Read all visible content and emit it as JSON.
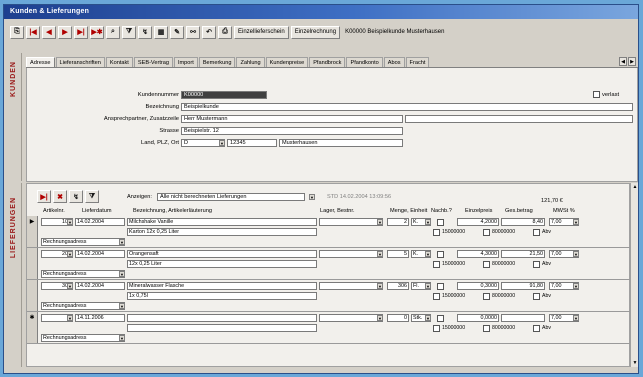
{
  "window": {
    "title": "Kunden & Lieferungen"
  },
  "toolbar": {
    "buttons": [
      "first",
      "prev",
      "next",
      "last",
      "new",
      "search",
      "filter",
      "sort",
      "print",
      "copy",
      "find",
      "refresh",
      "delete"
    ],
    "btn1": "Einzellieferschein",
    "btn2": "Einzelrechnung",
    "info": "K00000 Beispielkunde Musterhausen"
  },
  "side": {
    "kunden": "KUNDEN",
    "lieferungen": "LIEFERUNGEN"
  },
  "tabs": [
    "Adresse",
    "Lieferanschriften",
    "Kontakt",
    "SEB-Vertrag",
    "Import",
    "Bemerkung",
    "Zahlung",
    "Kundenpreise",
    "Pfandbrock",
    "Pfandkonto",
    "Abos",
    "Fracht"
  ],
  "address": {
    "kundennummer_label": "Kundennummer",
    "kundennummer": "K00000",
    "verlast_label": "verlast",
    "bezeichnung_label": "Bezeichnung",
    "bezeichnung": "Beispielkunde",
    "ansprech_label": "Ansprechpartner, Zusatzzeile",
    "ansprech": "Herr Mustermann",
    "strasse_label": "Strasse",
    "strasse": "Beispielstr. 12",
    "ort_label": "Land, PLZ, Ort",
    "land": "D",
    "plz": "12345",
    "ort": "Musterhausen"
  },
  "deliveries": {
    "anzeigen_label": "Anzeigen:",
    "anzeigen_value": "Alle nicht berechneten Lieferungen",
    "stand": "STD 14.02.2004 13:09:56",
    "sum": "121,70 €",
    "headers": {
      "artikelnr": "Artikelnr.",
      "lieferdatum": "Lieferdatum",
      "bezeichnung": "Bezeichnung, Artikelerläuterung",
      "lager": "Lager, Bestnr.",
      "menge": "Menge, Einheit",
      "nachb": "Nachb.?",
      "einzelpreis": "Einzelpreis",
      "gesbetrag": "Ges.betrag",
      "mwst": "MWSt %"
    },
    "rows": [
      {
        "sel": "▶",
        "artnr": "101",
        "datum": "14.02.2004",
        "bez": "Milchshake Vanille",
        "bez2": "Karton 12x 0,25 Liter",
        "adr": "Rechnungsadress",
        "menge": "2",
        "einheit": "K.",
        "einzel": "4,2000",
        "ges": "8,40",
        "mwst": "7,00",
        "c1": "15000000",
        "c2": "80000000",
        "abv": "Abv"
      },
      {
        "sel": "",
        "artnr": "201",
        "datum": "14.02.2004",
        "bez": "Orangensaft",
        "bez2": "12x 0,25 Liter",
        "adr": "Rechnungsadress",
        "menge": "5",
        "einheit": "K.",
        "einzel": "4,3000",
        "ges": "21,50",
        "mwst": "7,00",
        "c1": "15000000",
        "c2": "80000000",
        "abv": "Abv"
      },
      {
        "sel": "",
        "artnr": "301",
        "datum": "14.02.2004",
        "bez": "Mineralwasser Flasche",
        "bez2": "1x 0,75l",
        "adr": "Rechnungsadress",
        "menge": "306",
        "einheit": "Fl.",
        "einzel": "0,3000",
        "ges": "91,80",
        "mwst": "7,00",
        "c1": "15000000",
        "c2": "80000000",
        "abv": "Abv"
      },
      {
        "sel": "✱",
        "artnr": "0",
        "datum": "14.11.2006",
        "bez": "",
        "bez2": "",
        "adr": "Rechnungsadress",
        "menge": "0",
        "einheit": "Stk.",
        "einzel": "0,0000",
        "ges": "",
        "mwst": "7,00",
        "c1": "15000000",
        "c2": "80000000",
        "abv": "Abv"
      }
    ]
  }
}
